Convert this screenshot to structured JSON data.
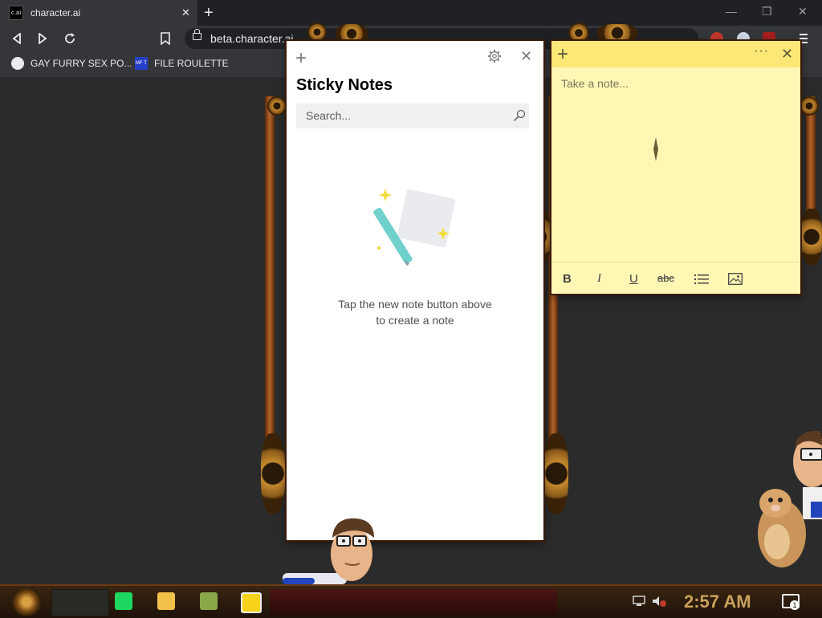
{
  "browser": {
    "tab_title": "character.ai",
    "favicon_text": "c.ai",
    "tab_close": "✕",
    "new_tab": "+",
    "url": "beta.character.ai",
    "window_controls": [
      "—",
      "❐",
      "✕"
    ],
    "nav_icons": [
      "back-icon",
      "forward-icon",
      "reload-icon",
      "bookmark-icon"
    ],
    "bookmarks": [
      {
        "label": "GAY FURRY SEX PO...",
        "icon": "globe-icon"
      },
      {
        "label": "FILE ROULETTE",
        "icon": "mft-icon",
        "icon_text": "MF T"
      }
    ]
  },
  "sticky_list": {
    "new_icon": "+",
    "close_icon": "✕",
    "title": "Sticky Notes",
    "search_placeholder": "Search...",
    "empty_line1": "Tap the new note button above",
    "empty_line2": "to create a note"
  },
  "note": {
    "new_icon": "+",
    "more_icon": "···",
    "close_icon": "✕",
    "placeholder": "Take a note...",
    "color": "#fff7b3",
    "toolbar": {
      "bold": "B",
      "italic": "I",
      "underline": "U",
      "strike": "abc"
    }
  },
  "taskbar": {
    "apps": [
      "spotify-icon",
      "file-explorer-icon",
      "game-icon",
      "sticky-notes-icon"
    ],
    "clock": "2:57 AM",
    "notification_count": "1"
  }
}
